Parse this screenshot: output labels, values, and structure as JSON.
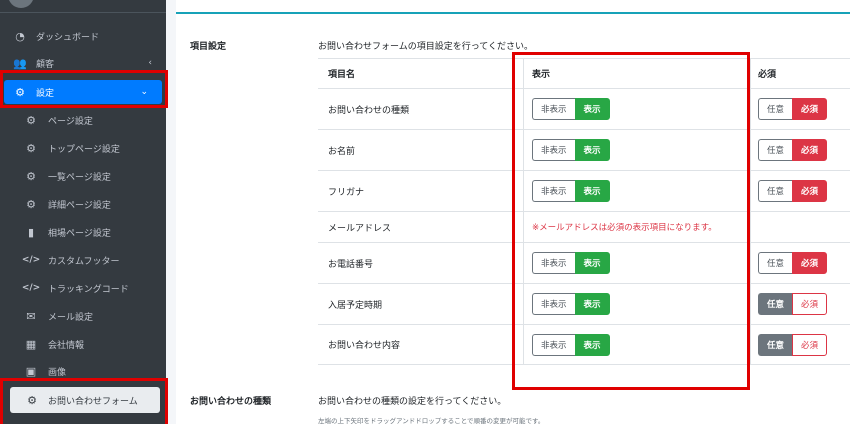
{
  "sidebar": {
    "items": [
      {
        "label": "ダッシュボード",
        "icon": "dashboard-icon",
        "glyph": "◔"
      },
      {
        "label": "顧客",
        "icon": "users-icon",
        "glyph": "👥",
        "chevron": "‹"
      },
      {
        "label": "設定",
        "icon": "cogs-icon",
        "glyph": "⚙",
        "chevron": "⌄"
      },
      {
        "label": "ページ設定",
        "icon": "cog-icon",
        "glyph": "⚙"
      },
      {
        "label": "トップページ設定",
        "icon": "cog-icon",
        "glyph": "⚙"
      },
      {
        "label": "一覧ページ設定",
        "icon": "cog-icon",
        "glyph": "⚙"
      },
      {
        "label": "詳細ページ設定",
        "icon": "cog-icon",
        "glyph": "⚙"
      },
      {
        "label": "相場ページ設定",
        "icon": "bar-chart-icon",
        "glyph": "▮"
      },
      {
        "label": "カスタムフッター",
        "icon": "code-icon",
        "glyph": "</>"
      },
      {
        "label": "トラッキングコード",
        "icon": "code-icon",
        "glyph": "</>"
      },
      {
        "label": "メール設定",
        "icon": "envelope-icon",
        "glyph": "✉"
      },
      {
        "label": "会社情報",
        "icon": "building-icon",
        "glyph": "▦"
      },
      {
        "label": "画像",
        "icon": "image-icon",
        "glyph": "▣"
      },
      {
        "label": "お問い合わせフォーム",
        "icon": "cog-icon",
        "glyph": "⚙"
      }
    ]
  },
  "section1": {
    "label": "項目設定",
    "description": "お問い合わせフォームの項目設定を行ってください。",
    "headers": {
      "name": "項目名",
      "display": "表示",
      "required": "必須"
    },
    "rows": [
      {
        "name": "お問い合わせの種類",
        "display_off": "非表示",
        "display_on": "表示",
        "opt": "任意",
        "req": "必須",
        "req_state": "required"
      },
      {
        "name": "お名前",
        "display_off": "非表示",
        "display_on": "表示",
        "opt": "任意",
        "req": "必須",
        "req_state": "required"
      },
      {
        "name": "フリガナ",
        "display_off": "非表示",
        "display_on": "表示",
        "opt": "任意",
        "req": "必須",
        "req_state": "required"
      },
      {
        "name": "メールアドレス",
        "note": "※メールアドレスは必須の表示項目になります。"
      },
      {
        "name": "お電話番号",
        "display_off": "非表示",
        "display_on": "表示",
        "opt": "任意",
        "req": "必須",
        "req_state": "required"
      },
      {
        "name": "入居予定時期",
        "display_off": "非表示",
        "display_on": "表示",
        "opt": "任意",
        "req": "必須",
        "req_state": "optional"
      },
      {
        "name": "お問い合わせ内容",
        "display_off": "非表示",
        "display_on": "表示",
        "opt": "任意",
        "req": "必須",
        "req_state": "optional"
      }
    ]
  },
  "section2": {
    "label": "お問い合わせの種類",
    "description": "お問い合わせの種類の設定を行ってください。",
    "hint": "左端の上下矢印をドラッグアンドドロップすることで順番の変更が可能です。"
  },
  "colors": {
    "sidebar_bg": "#343a40",
    "active": "#007bff",
    "green": "#28a745",
    "red": "#dc3545",
    "secondary": "#6c757d",
    "highlight": "#e00000"
  }
}
